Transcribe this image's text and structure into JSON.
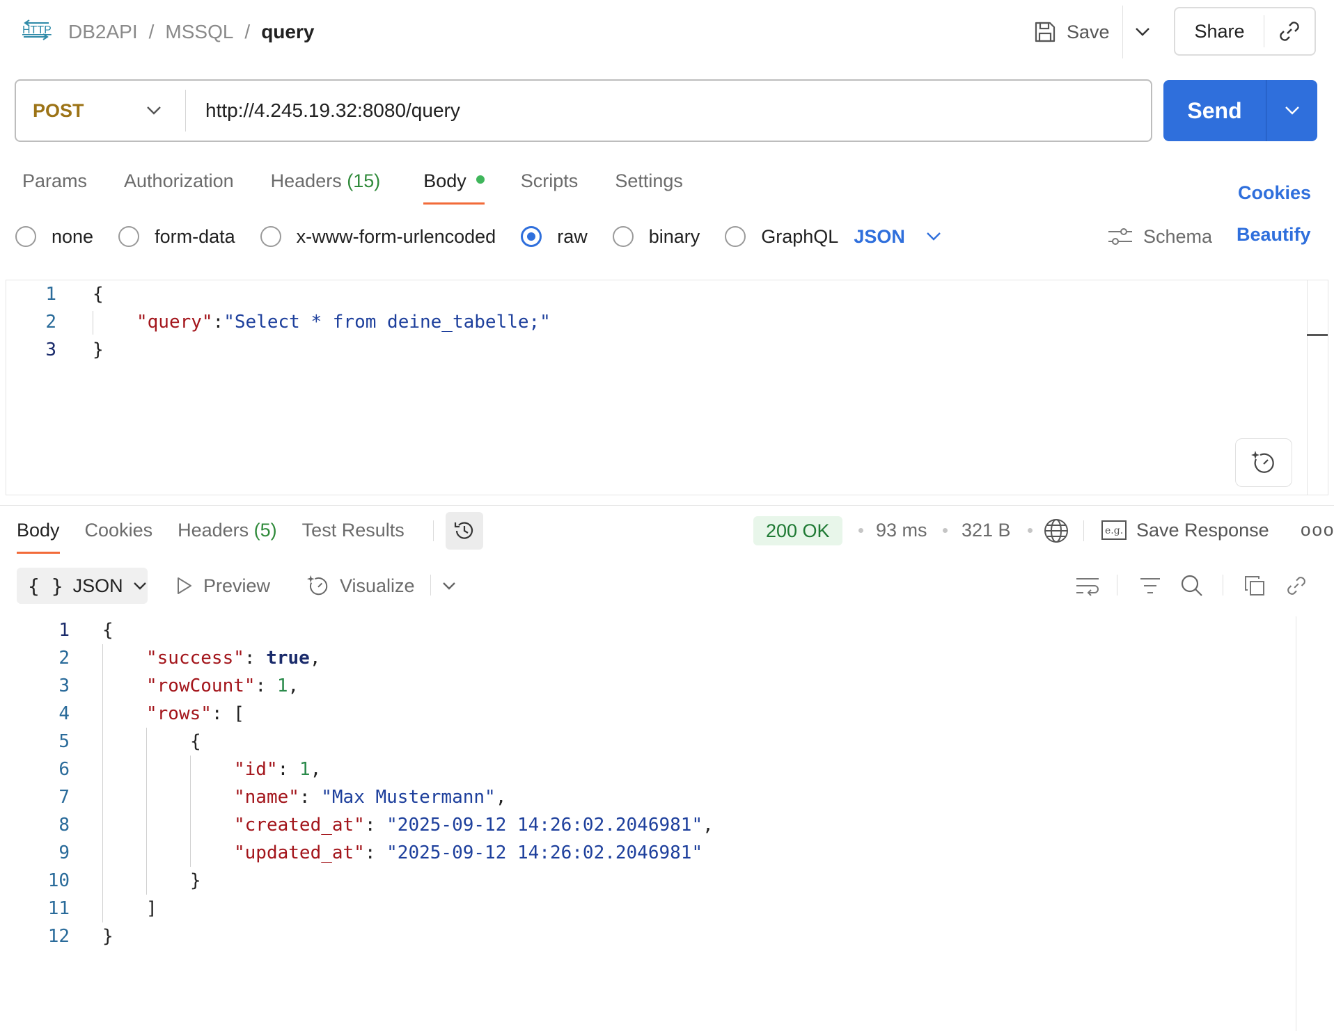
{
  "header": {
    "breadcrumb": [
      "DB2API",
      "MSSQL",
      "query"
    ],
    "separator": "/",
    "save_label": "Save",
    "share_label": "Share"
  },
  "request": {
    "method": "POST",
    "url": "http://4.245.19.32:8080/query",
    "send_label": "Send"
  },
  "request_tabs": {
    "params": "Params",
    "authorization": "Authorization",
    "headers": "Headers",
    "headers_count": "(15)",
    "body": "Body",
    "scripts": "Scripts",
    "settings": "Settings",
    "cookies": "Cookies"
  },
  "body_types": {
    "options": [
      "none",
      "form-data",
      "x-www-form-urlencoded",
      "raw",
      "binary",
      "GraphQL"
    ],
    "selected": "raw",
    "format": "JSON",
    "schema": "Schema",
    "beautify": "Beautify"
  },
  "request_body": {
    "line_numbers": [
      "1",
      "2",
      "3"
    ],
    "open_brace": "{",
    "key": "\"query\"",
    "colon": ":",
    "value": "\"Select * from deine_tabelle;\"",
    "close_brace": "}"
  },
  "response_tabs": {
    "body": "Body",
    "cookies": "Cookies",
    "headers": "Headers",
    "headers_count": "(5)",
    "test_results": "Test Results"
  },
  "response_meta": {
    "status": "200 OK",
    "time": "93 ms",
    "size": "321 B",
    "save_response": "Save Response",
    "more": "ooo"
  },
  "response_toolbar": {
    "format": "JSON",
    "format_icon": "{ }",
    "preview": "Preview",
    "visualize": "Visualize"
  },
  "response_body": {
    "line_numbers": [
      "1",
      "2",
      "3",
      "4",
      "5",
      "6",
      "7",
      "8",
      "9",
      "10",
      "11",
      "12"
    ],
    "success_key": "\"success\"",
    "success_val": "true",
    "rowcount_key": "\"rowCount\"",
    "rowcount_val": "1",
    "rows_key": "\"rows\"",
    "id_key": "\"id\"",
    "id_val": "1",
    "name_key": "\"name\"",
    "name_val": "\"Max Mustermann\"",
    "created_key": "\"created_at\"",
    "created_val": "\"2025-09-12 14:26:02.2046981\"",
    "updated_key": "\"updated_at\"",
    "updated_val": "\"2025-09-12 14:26:02.2046981\""
  }
}
